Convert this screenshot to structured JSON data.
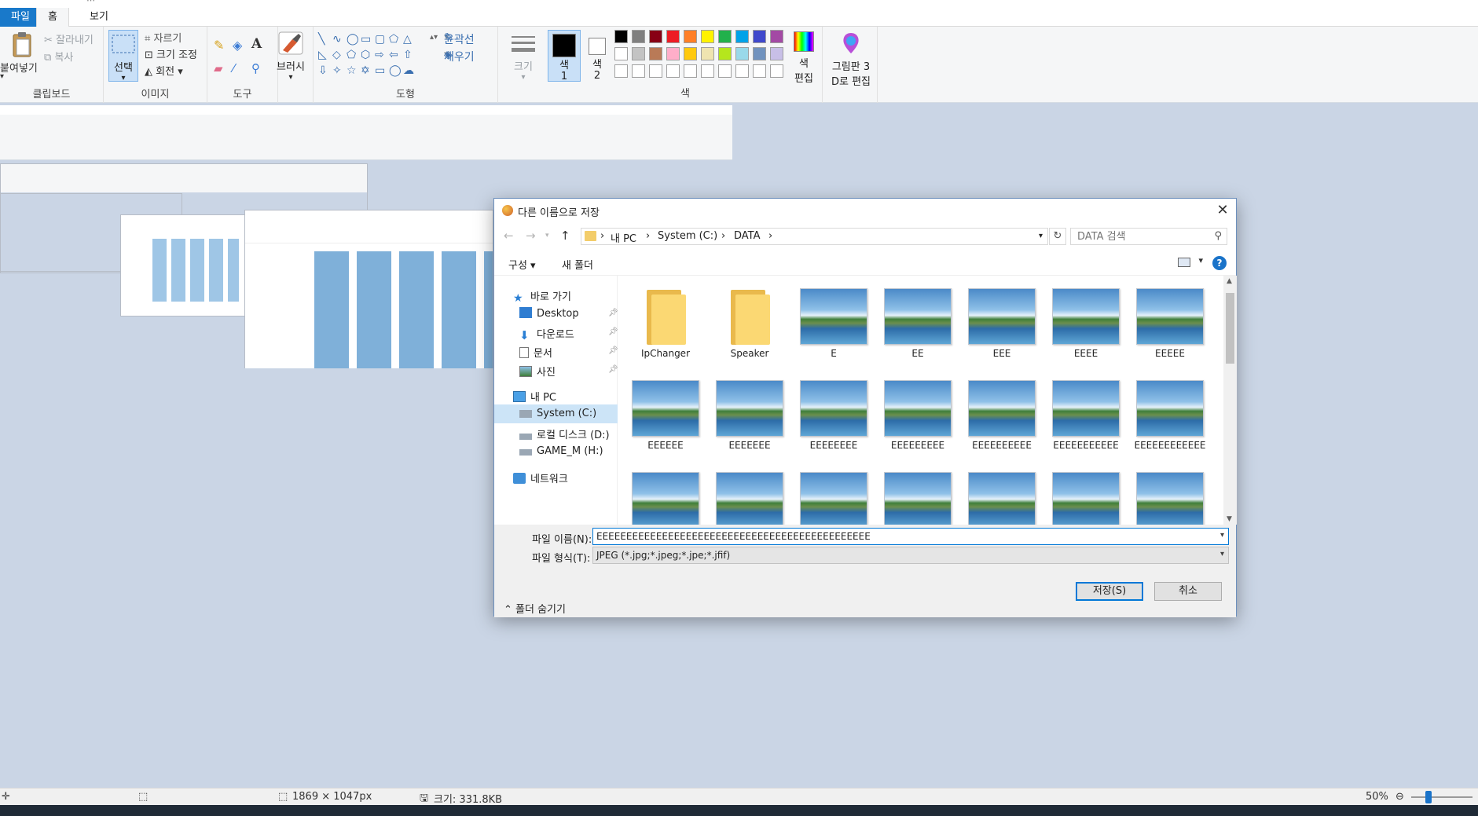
{
  "app": {
    "menu": {
      "file": "파일",
      "home": "홈",
      "view": "보기"
    },
    "ribbon": {
      "clipboard": {
        "paste": "붙여넣기",
        "cut": "잘라내기",
        "copy": "복사",
        "label": "클립보드"
      },
      "image": {
        "select": "선택",
        "crop": "자르기",
        "resize": "크기 조정",
        "rotate": "회전",
        "label": "이미지"
      },
      "tools": {
        "label": "도구"
      },
      "brushes": {
        "label": "브러시"
      },
      "shapes": {
        "outline": "윤곽선",
        "fill": "채우기",
        "label": "도형"
      },
      "size": {
        "label": "크기"
      },
      "colors": {
        "color1": "색\n1",
        "color1_a": "색",
        "color1_b": "1",
        "color2_a": "색",
        "color2_b": "2",
        "edit_a": "색",
        "edit_b": "편집",
        "label": "색",
        "palette_row1": [
          "#000000",
          "#7f7f7f",
          "#880015",
          "#ed1c24",
          "#ff7f27",
          "#fff200",
          "#22b14c",
          "#00a2e8",
          "#3f48cc",
          "#a349a4"
        ],
        "palette_row2": [
          "#ffffff",
          "#c3c3c3",
          "#b97a57",
          "#ffaec9",
          "#ffc90e",
          "#efe4b0",
          "#b5e61d",
          "#99d9ea",
          "#7092be",
          "#c8bfe7"
        ]
      },
      "paint3d_a": "그림판 3",
      "paint3d_b": "D로 편집"
    },
    "status": {
      "dimensions": "1869 × 1047px",
      "size": "크기: 331.8KB",
      "zoom": "50%"
    }
  },
  "dialog": {
    "title": "다른 이름으로 저장",
    "close": "✕",
    "path": [
      "내 PC",
      "System (C:)",
      "DATA"
    ],
    "search_placeholder": "DATA 검색",
    "organize": "구성 ▾",
    "new_folder": "새 폴더",
    "help": "?",
    "nav": {
      "quick_access": "바로 가기",
      "desktop": "Desktop",
      "downloads": "다운로드",
      "documents": "문서",
      "pictures": "사진",
      "this_pc": "내 PC",
      "system_c": "System (C:)",
      "local_d": "로컬 디스크 (D:)",
      "game_h": "GAME_M (H:)",
      "network": "네트워크"
    },
    "files_row1": [
      {
        "name": "IpChanger",
        "type": "folder"
      },
      {
        "name": "Speaker",
        "type": "folder"
      },
      {
        "name": "E",
        "type": "image"
      },
      {
        "name": "EE",
        "type": "image"
      },
      {
        "name": "EEE",
        "type": "image"
      },
      {
        "name": "EEEE",
        "type": "image"
      },
      {
        "name": "EEEEE",
        "type": "image"
      }
    ],
    "files_row2": [
      {
        "name": "EEEEEE",
        "type": "image"
      },
      {
        "name": "EEEEEEE",
        "type": "image"
      },
      {
        "name": "EEEEEEEE",
        "type": "image"
      },
      {
        "name": "EEEEEEEEE",
        "type": "image"
      },
      {
        "name": "EEEEEEEEEE",
        "type": "image"
      },
      {
        "name": "EEEEEEEEEEE",
        "type": "image"
      },
      {
        "name": "EEEEEEEEEEEE",
        "type": "image"
      }
    ],
    "files_row3_count_visible": 7,
    "filename_label": "파일 이름(N):",
    "filename_value": "EEEEEEEEEEEEEEEEEEEEEEEEEEEEEEEEEEEEEEEEEEEEEE",
    "filetype_label": "파일 형식(T):",
    "filetype_value": "JPEG (*.jpg;*.jpeg;*.jpe;*.jfif)",
    "save": "저장(S)",
    "cancel": "취소",
    "hide_folders": "폴더 숨기기"
  }
}
